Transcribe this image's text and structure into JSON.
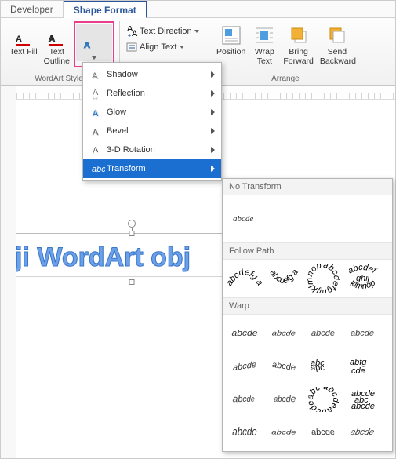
{
  "tabs": {
    "developer": "Developer",
    "shape_format": "Shape Format"
  },
  "ribbon": {
    "wordart_group_label": "WordArt Styles",
    "arrange_group_label": "Arrange",
    "text_fill": "Text Fill",
    "text_outline": "Text\nOutline",
    "text_direction": "Text Direction",
    "align_text": "Align Text",
    "position": "Position",
    "wrap_text": "Wrap\nText",
    "bring_forward": "Bring\nForward",
    "send_backward": "Send\nBackward"
  },
  "menu": {
    "items": [
      {
        "label": "Shadow",
        "icon": "shadow"
      },
      {
        "label": "Reflection",
        "icon": "reflection"
      },
      {
        "label": "Glow",
        "icon": "glow"
      },
      {
        "label": "Bevel",
        "icon": "bevel"
      },
      {
        "label": "3-D Rotation",
        "icon": "rotation3d"
      },
      {
        "label": "Transform",
        "icon": "transform",
        "selected": true
      }
    ]
  },
  "gallery": {
    "no_transform_header": "No Transform",
    "no_transform_sample": "abcde",
    "follow_path_header": "Follow Path",
    "warp_header": "Warp",
    "warp_sample": "abcde"
  },
  "canvas": {
    "wordart_text": "ji WordArt obj"
  }
}
